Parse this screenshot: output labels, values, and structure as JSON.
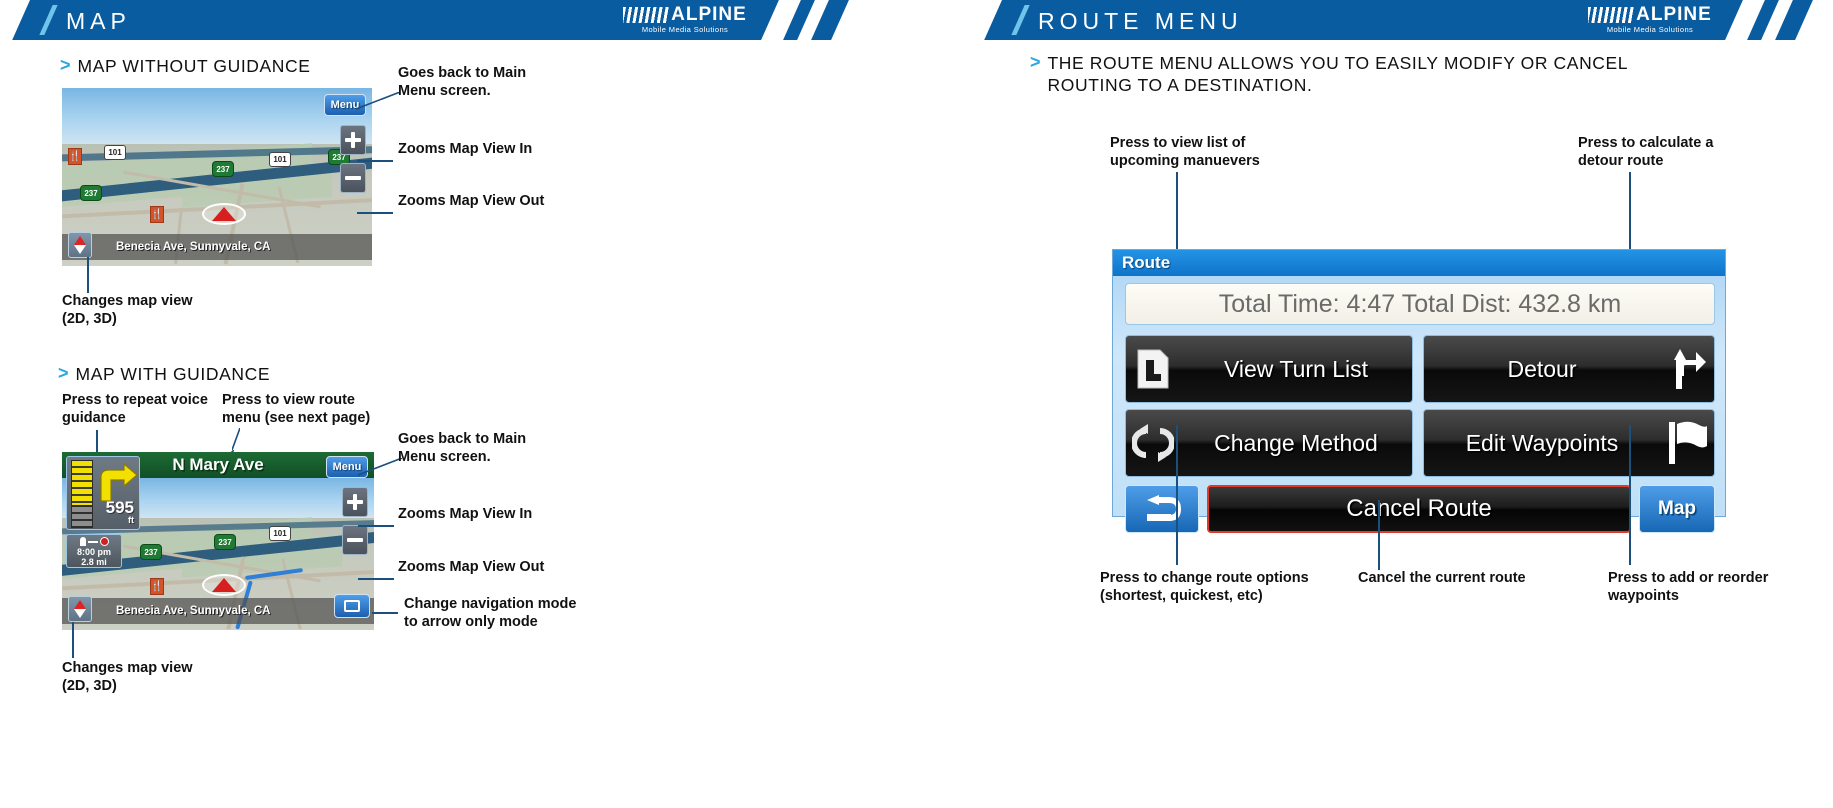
{
  "header": {
    "left_title": "MAP",
    "right_title": "ROUTE MENU",
    "logo_text": "ALPINE",
    "logo_tagline": "Mobile Media Solutions",
    "logo_reg": "®"
  },
  "left_page": {
    "section1_title": "MAP WITHOUT GUIDANCE",
    "section2_title": "MAP WITH GUIDANCE",
    "annotations": {
      "menu_1": "Goes back to Main\nMenu screen.",
      "zoom_in_1": "Zooms Map View In",
      "zoom_out_1": "Zooms Map View Out",
      "map_view_1": "Changes map view\n(2D, 3D)",
      "repeat_voice": "Press to repeat voice\nguidance",
      "route_menu": "Press to view route\nmenu (see next page)",
      "menu_2": "Goes back to Main\nMenu screen.",
      "zoom_in_2": "Zooms Map View In",
      "zoom_out_2": "Zooms Map View Out",
      "arrow_mode": "Change navigation mode\nto arrow only mode",
      "map_view_2": "Changes map view\n(2D, 3D)"
    },
    "map1": {
      "menu_button": "Menu",
      "address": "Benecia Ave, Sunnyvale, CA",
      "shield_us_1": "101",
      "shield_us_2": "101",
      "shield_state_1": "237",
      "shield_state_2": "237",
      "shield_state_3": "237"
    },
    "map2": {
      "menu_button": "Menu",
      "street_name": "N Mary Ave",
      "turn_distance": "595",
      "turn_distance_unit": "ft",
      "eta_time": "8:00 pm",
      "eta_distance": "2.8 mi",
      "address": "Benecia Ave, Sunnyvale, CA",
      "shield_us_1": "101",
      "shield_state_1": "237",
      "shield_state_2": "237"
    }
  },
  "right_page": {
    "intro": "THE ROUTE MENU ALLOWS YOU TO EASILY MODIFY OR CANCEL\nROUTING TO A DESTINATION.",
    "annotations": {
      "turn_list": "Press to view list of\nupcoming manuevers",
      "detour": "Press to calculate a\ndetour route",
      "change_method": "Press to change route options\n(shortest, quickest, etc)",
      "cancel_route": "Cancel the current route",
      "edit_waypoints": "Press to add or reorder\nwaypoints"
    },
    "device": {
      "title": "Route",
      "info": "Total Time: 4:47  Total Dist: 432.8 km",
      "buttons": [
        {
          "label": "View Turn List",
          "icon": "turn-list-icon"
        },
        {
          "label": "Detour",
          "icon": "detour-arrow-icon"
        },
        {
          "label": "Change Method",
          "icon": "refresh-cycle-icon"
        },
        {
          "label": "Edit Waypoints",
          "icon": "flag-icon"
        }
      ],
      "cancel_label": "Cancel Route",
      "back_icon": "back-arrow-icon",
      "map_label": "Map"
    }
  },
  "colors": {
    "banner_blue": "#0a5ca0",
    "accent_cyan": "#2ba6e0",
    "leader_line": "#1b4f7e",
    "cancel_red": "#e03b2a"
  }
}
